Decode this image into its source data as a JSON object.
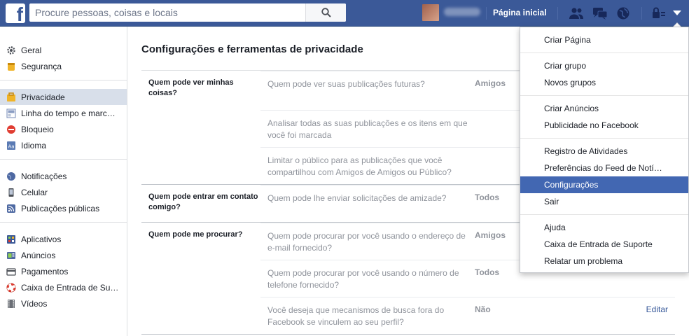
{
  "topbar": {
    "search_placeholder": "Procure pessoas, coisas e locais",
    "home_label": "Página inicial"
  },
  "sidebar": {
    "groups": [
      [
        {
          "label": "Geral",
          "icon": "gear-icon"
        },
        {
          "label": "Segurança",
          "icon": "shield-icon"
        }
      ],
      [
        {
          "label": "Privacidade",
          "icon": "lock-icon",
          "active": true
        },
        {
          "label": "Linha do tempo e marc…",
          "icon": "timeline-icon"
        },
        {
          "label": "Bloqueio",
          "icon": "block-icon"
        },
        {
          "label": "Idioma",
          "icon": "language-icon"
        }
      ],
      [
        {
          "label": "Notificações",
          "icon": "globe-icon"
        },
        {
          "label": "Celular",
          "icon": "phone-icon"
        },
        {
          "label": "Publicações públicas",
          "icon": "rss-icon"
        }
      ],
      [
        {
          "label": "Aplicativos",
          "icon": "apps-icon"
        },
        {
          "label": "Anúncios",
          "icon": "ads-icon"
        },
        {
          "label": "Pagamentos",
          "icon": "card-icon"
        },
        {
          "label": "Caixa de Entrada de Su…",
          "icon": "lifebuoy-icon"
        },
        {
          "label": "Vídeos",
          "icon": "film-icon"
        }
      ]
    ]
  },
  "main": {
    "title": "Configurações e ferramentas de privacidade",
    "sections": [
      {
        "label": "Quem pode ver minhas coisas?",
        "rows": [
          {
            "question": "Quem pode ver suas publicações futuras?",
            "value": "Amigos",
            "height": 56
          },
          {
            "question": "Analisar todas as suas publicações e os itens em que você foi marcada",
            "value": "",
            "height": 52
          },
          {
            "question": "Limitar o público para as publicações que você compartilhou com Amigos de Amigos ou Público?",
            "value": "",
            "height": 53
          }
        ]
      },
      {
        "label": "Quem pode entrar em contato comigo?",
        "rows": [
          {
            "question": "Quem pode lhe enviar solicitações de amizade?",
            "value": "Todos",
            "height": 51
          }
        ]
      },
      {
        "label": "Quem pode me procurar?",
        "rows": [
          {
            "question": "Quem pode procurar por você usando o endereço de e-mail fornecido?",
            "value": "Amigos",
            "height": 53
          },
          {
            "question": "Quem pode procurar por você usando o número de telefone fornecido?",
            "value": "Todos",
            "height": 53
          },
          {
            "question": "Você deseja que mecanismos de busca fora do Facebook se vinculem ao seu perfil?",
            "value": "Não",
            "height": 53,
            "edit": "Editar"
          }
        ]
      }
    ]
  },
  "menu": {
    "groups": [
      [
        {
          "label": "Criar Página"
        }
      ],
      [
        {
          "label": "Criar grupo"
        },
        {
          "label": "Novos grupos"
        }
      ],
      [
        {
          "label": "Criar Anúncios"
        },
        {
          "label": "Publicidade no Facebook"
        }
      ],
      [
        {
          "label": "Registro de Atividades"
        },
        {
          "label": "Preferências do Feed de Notí…"
        },
        {
          "label": "Configurações",
          "active": true
        },
        {
          "label": "Sair"
        }
      ],
      [
        {
          "label": "Ajuda"
        },
        {
          "label": "Caixa de Entrada de Suporte"
        },
        {
          "label": "Relatar um problema"
        }
      ]
    ]
  },
  "colors": {
    "brand": "#3b5998",
    "menu_highlight": "#4267b2",
    "sidebar_active": "#d8dfea",
    "link": "#365899"
  }
}
